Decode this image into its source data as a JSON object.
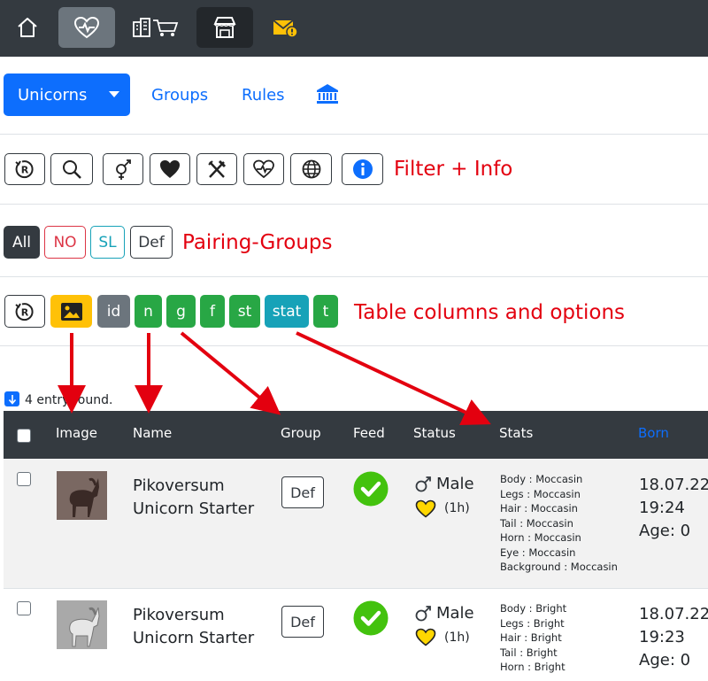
{
  "navbar": {
    "icons": [
      "home-icon",
      "heart-pulse-icon",
      "city-cart-icon",
      "shop-icon",
      "mail-warning-icon"
    ]
  },
  "tabs": {
    "dropdown_label": "Unicorns",
    "groups_label": "Groups",
    "rules_label": "Rules"
  },
  "filter_row": {
    "annotation": "Filter + Info"
  },
  "pairing_row": {
    "buttons": [
      "All",
      "NO",
      "SL",
      "Def"
    ],
    "annotation": "Pairing-Groups"
  },
  "columns_row": {
    "buttons": [
      "id",
      "n",
      "g",
      "f",
      "st",
      "stat",
      "t"
    ],
    "annotation": "Table columns and options"
  },
  "entries_text": "4 entry found.",
  "table": {
    "headers": [
      "Image",
      "Name",
      "Group",
      "Feed",
      "Status",
      "Stats",
      "Born"
    ],
    "rows": [
      {
        "name_line1": "Pikoversum",
        "name_line2": "Unicorn Starter",
        "group": "Def",
        "status_gender": "Male",
        "status_time": "(1h)",
        "stats": [
          "Body : Moccasin",
          "Legs : Moccasin",
          "Hair  : Moccasin",
          "Tail : Moccasin",
          "Horn : Moccasin",
          "Eye : Moccasin",
          "Background : Moccasin"
        ],
        "born_date": "18.07.22",
        "born_time": "19:24",
        "age": "Age: 0"
      },
      {
        "name_line1": "Pikoversum",
        "name_line2": "Unicorn Starter",
        "group": "Def",
        "status_gender": "Male",
        "status_time": "(1h)",
        "stats": [
          "Body : Bright",
          "Legs : Bright",
          "Hair  : Bright",
          "Tail : Bright",
          "Horn : Bright"
        ],
        "born_date": "18.07.22",
        "born_time": "19:23",
        "age": "Age: 0"
      }
    ]
  },
  "colors": {
    "navbar": "#343a40",
    "primary": "#0d6efd",
    "success": "#28a745",
    "info": "#17a2b8",
    "warning": "#ffc107",
    "secondary": "#6c757d",
    "danger": "#dc3545",
    "annotation": "#e3000f"
  }
}
